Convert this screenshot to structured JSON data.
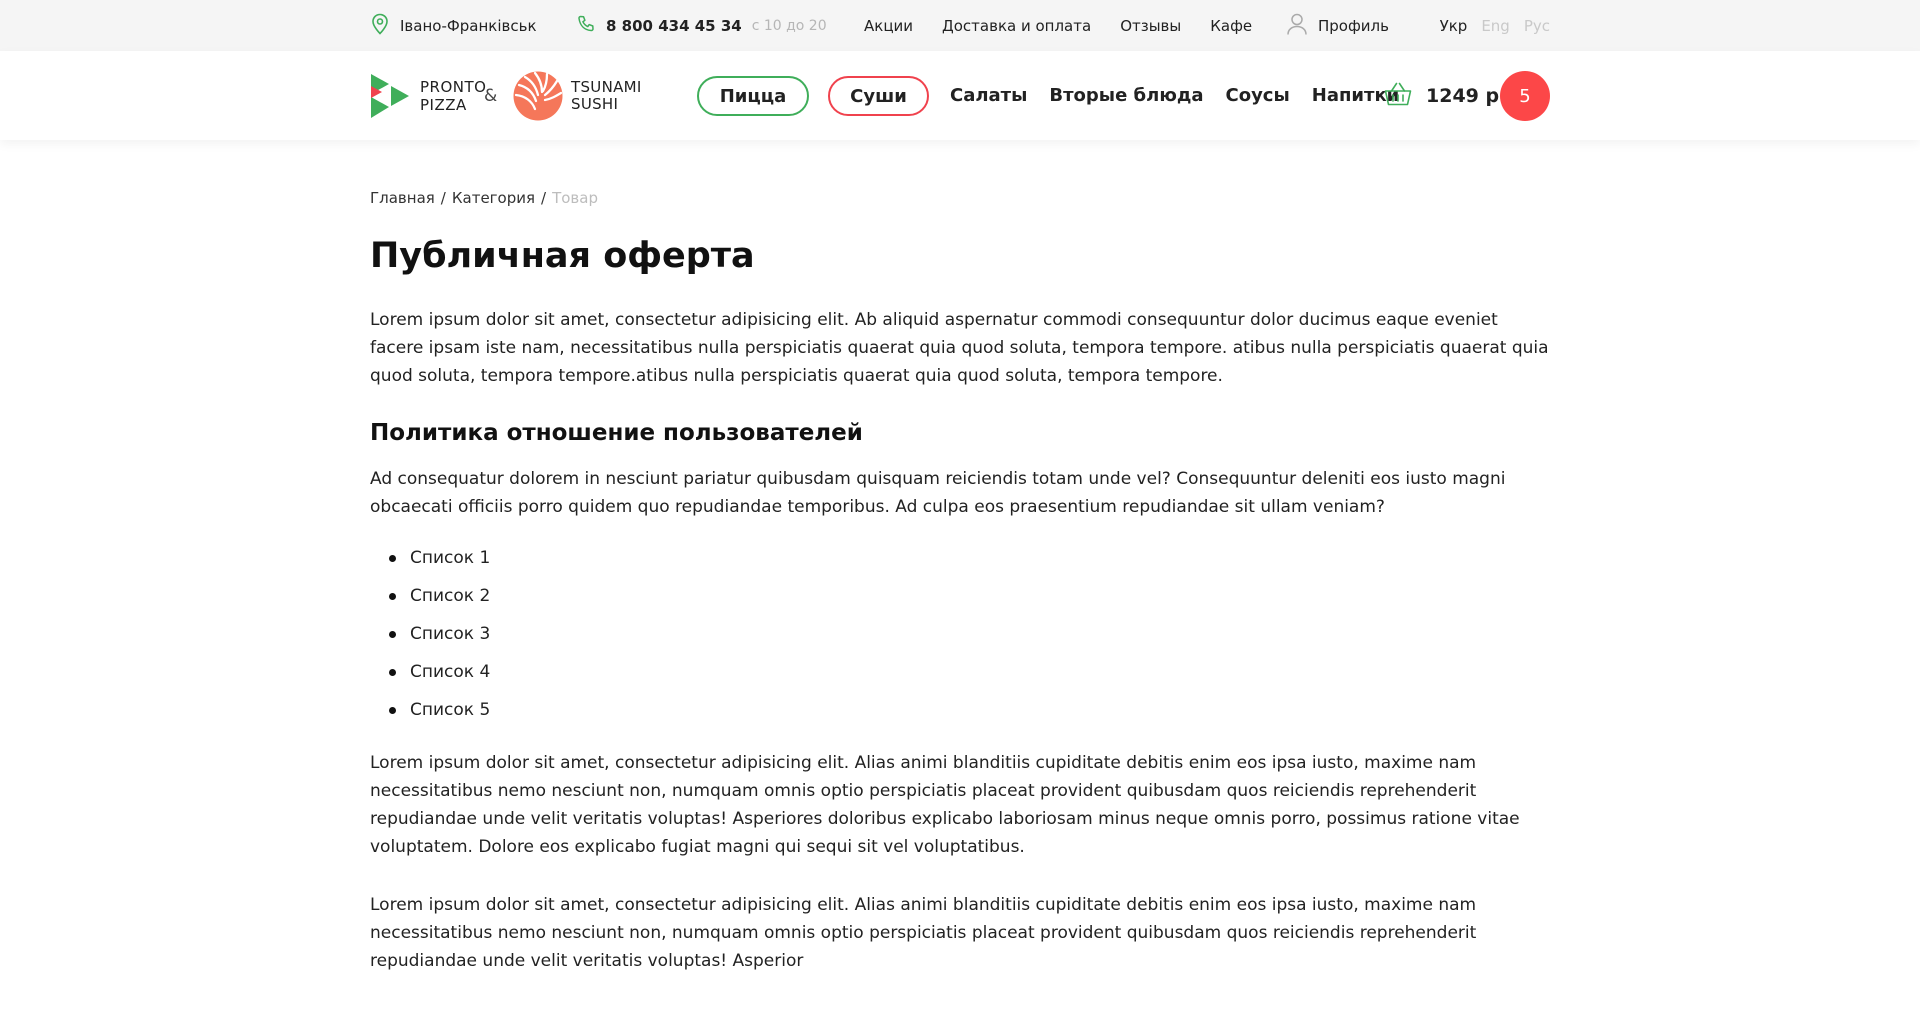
{
  "topbar": {
    "city": "Івано-Франківськ",
    "phone": "8 800 434 45 34",
    "hours": "с 10 до 20",
    "nav": [
      "Акции",
      "Доставка и оплата",
      "Отзывы",
      "Кафе"
    ],
    "profile": "Профиль",
    "languages": [
      "Укр",
      "Eng",
      "Рус"
    ]
  },
  "header": {
    "logo_pronto_line1": "PRONTO",
    "logo_pronto_line2": "PIZZA",
    "amp": "&",
    "logo_tsunami_line1": "TSUNAMI",
    "logo_tsunami_line2": "SUSHI",
    "pill_pizza": "Пицца",
    "pill_sushi": "Суши",
    "nav": [
      "Салаты",
      "Вторые блюда",
      "Соусы",
      "Напитки"
    ],
    "cart_sum": "1249 р",
    "cart_count": "5",
    "colors": {
      "green": "#3fae5a",
      "red": "#f0424d",
      "badge": "#fc4748"
    }
  },
  "breadcrumb": {
    "items": [
      "Главная",
      "Категория"
    ],
    "separator": "/",
    "current": "Товар"
  },
  "page": {
    "title": "Публичная оферта",
    "paragraph1": "Lorem ipsum dolor sit amet, consectetur adipisicing elit. Ab aliquid aspernatur commodi consequuntur dolor ducimus eaque eveniet facere ipsam iste nam, necessitatibus nulla perspiciatis quaerat quia quod soluta, tempora tempore. atibus nulla perspiciatis quaerat quia quod soluta, tempora tempore.atibus nulla perspiciatis quaerat quia quod soluta, tempora tempore.",
    "subtitle": "Политика отношение пользователей",
    "paragraph2": "Ad consequatur dolorem in nesciunt pariatur quibusdam quisquam reiciendis totam unde vel? Consequuntur deleniti eos iusto magni obcaecati officiis porro quidem quo repudiandae temporibus. Ad culpa eos praesentium repudiandae sit ullam veniam?",
    "list": [
      "Список 1",
      "Список 2",
      "Список 3",
      "Список 4",
      "Список 5"
    ],
    "paragraph3": "Lorem ipsum dolor sit amet, consectetur adipisicing elit. Alias animi blanditiis cupiditate debitis enim eos ipsa iusto, maxime nam necessitatibus nemo nesciunt non, numquam omnis optio perspiciatis placeat provident quibusdam quos reiciendis reprehenderit repudiandae unde velit veritatis voluptas! Asperiores doloribus explicabo laboriosam minus neque omnis porro, possimus ratione vitae voluptatem. Dolore eos explicabo fugiat magni qui sequi sit vel voluptatibus.",
    "paragraph4": "Lorem ipsum dolor sit amet, consectetur adipisicing elit. Alias animi blanditiis cupiditate debitis enim eos ipsa iusto, maxime nam necessitatibus nemo nesciunt non, numquam omnis optio perspiciatis placeat provident quibusdam quos reiciendis reprehenderit repudiandae unde velit veritatis voluptas! Asperior"
  },
  "icons": {
    "location": "location-pin-icon",
    "phone": "phone-icon",
    "profile": "user-icon",
    "cart": "basket-icon",
    "pronto_logo": "pronto-pizza-logo",
    "tsunami_logo": "tsunami-sushi-logo"
  }
}
